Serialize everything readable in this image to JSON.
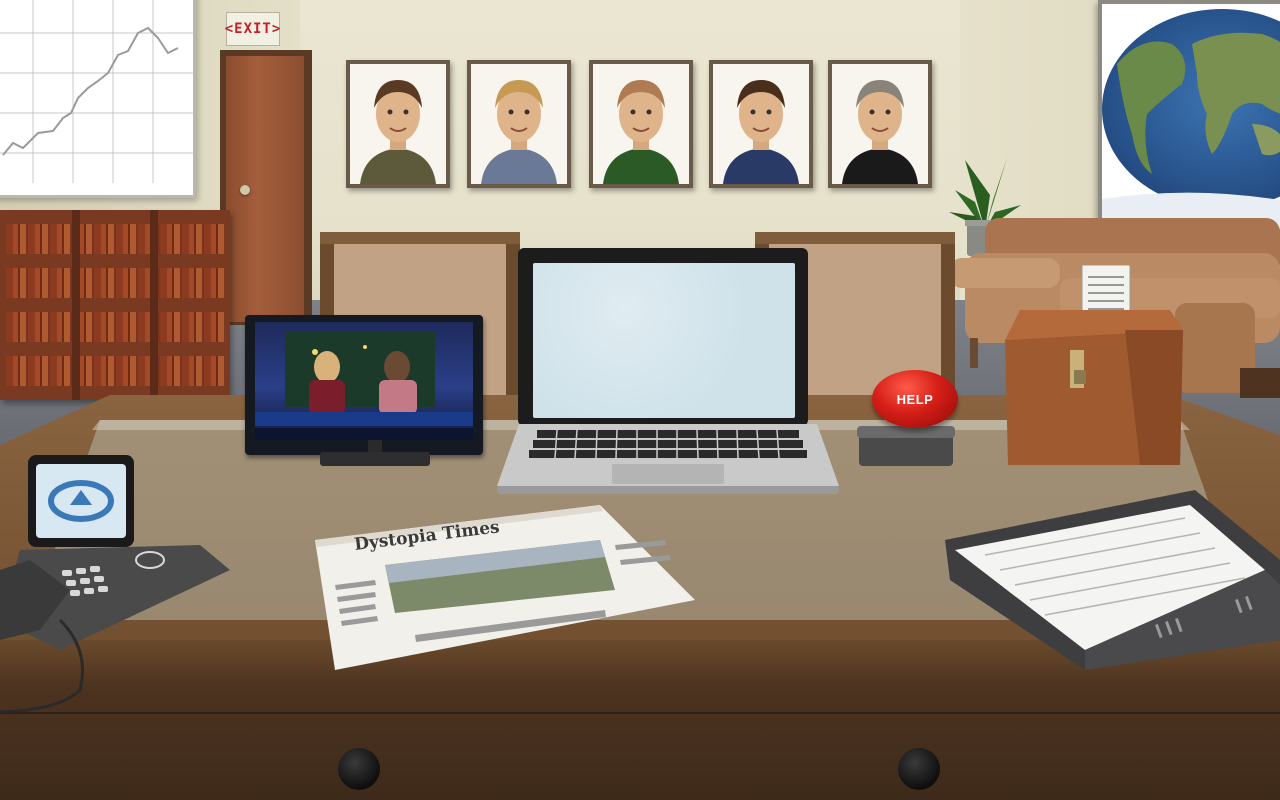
{
  "scene": {
    "exit_sign": "<EXIT>",
    "help_button_label": "HELP",
    "newspaper_masthead": "Dystopia Times",
    "portraits": [
      {
        "name": "portrait-bearded-man",
        "hair": "#5a3a22",
        "shirt": "#5c5a3a"
      },
      {
        "name": "portrait-blonde-woman",
        "hair": "#c69a52",
        "shirt": "#6a7a96"
      },
      {
        "name": "portrait-bald-man-green-shirt",
        "hair": "#b07a52",
        "shirt": "#2c5a26"
      },
      {
        "name": "portrait-man-with-glasses",
        "hair": "#4a2e1c",
        "shirt": "#2a3a66"
      },
      {
        "name": "portrait-older-man",
        "hair": "#8a8478",
        "shirt": "#1a1a1a"
      }
    ],
    "colors": {
      "wall": "#e6e1ca",
      "desk": "#6b4a2c",
      "help_red": "#d41e16",
      "laptop_screen": "#cfe2ea"
    }
  }
}
